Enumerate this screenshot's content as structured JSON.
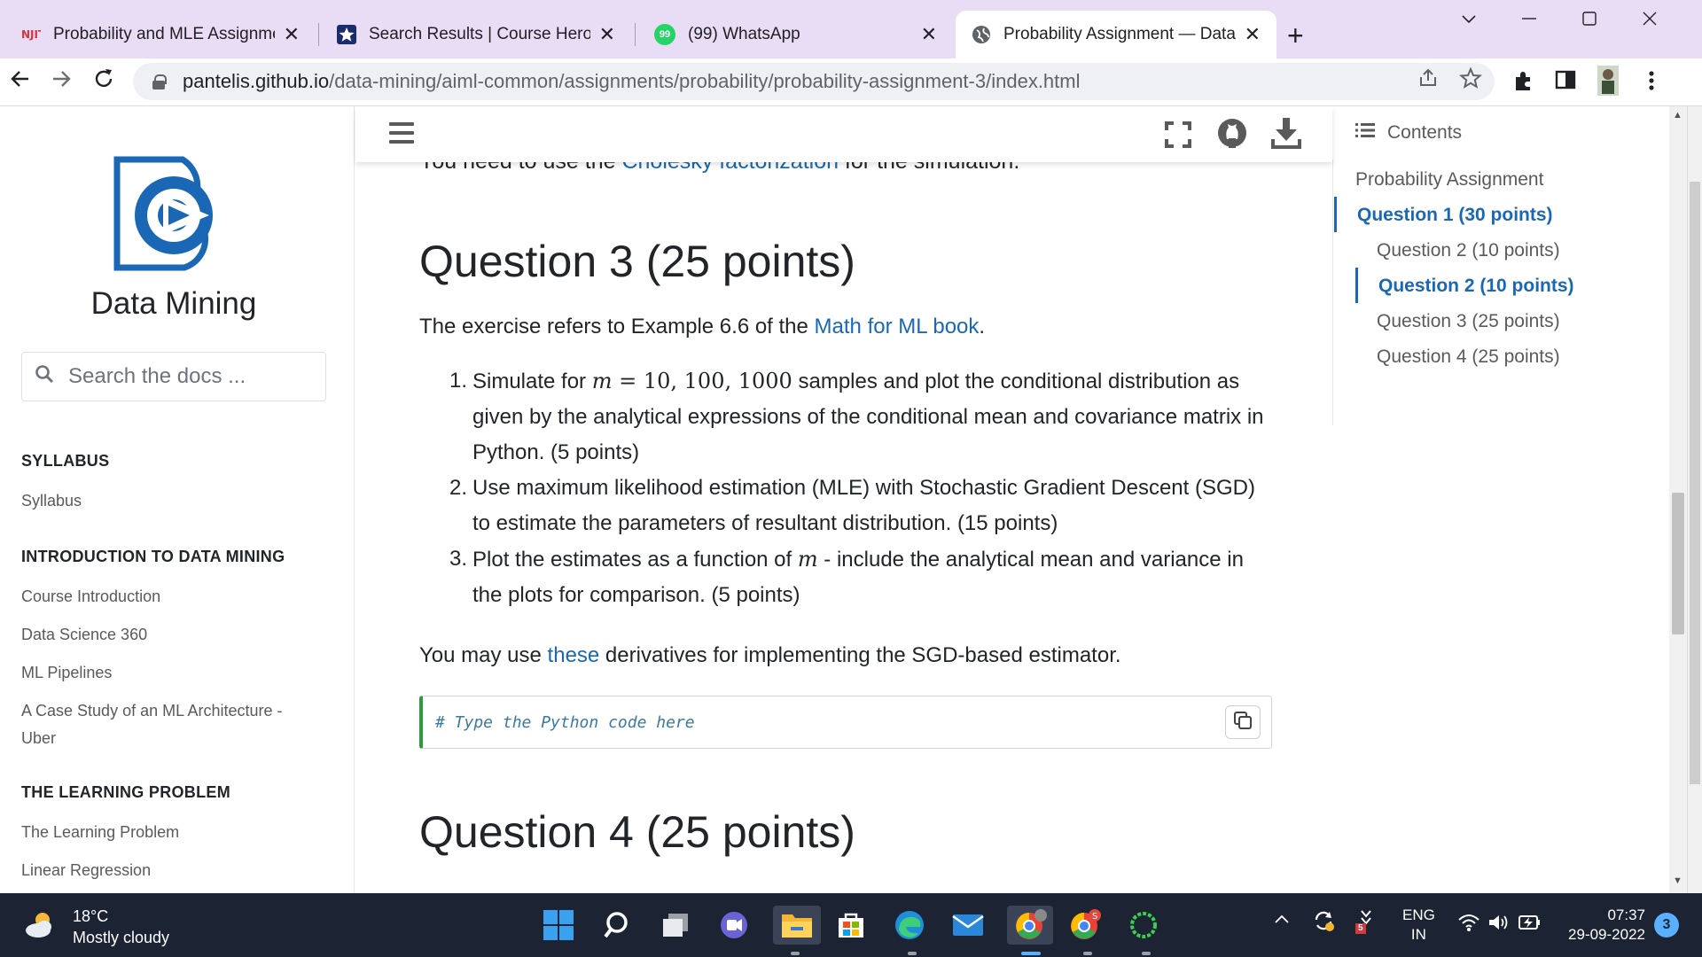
{
  "browser": {
    "tabs": [
      {
        "title": "Probability and MLE Assignment",
        "close": "✕"
      },
      {
        "title": "Search Results | Course Hero",
        "close": "✕"
      },
      {
        "title": "(99) WhatsApp",
        "badge": "99",
        "close": "✕"
      },
      {
        "title": "Probability Assignment — Data M",
        "close": "✕"
      }
    ],
    "url_host": "pantelis.github.io",
    "url_path": "/data-mining/aiml-common/assignments/probability/probability-assignment-3/index.html"
  },
  "sidebar": {
    "site_title": "Data Mining",
    "search_placeholder": "Search the docs ...",
    "sections": [
      {
        "caption": "SYLLABUS",
        "links": [
          "Syllabus"
        ]
      },
      {
        "caption": "INTRODUCTION TO DATA MINING",
        "links": [
          "Course Introduction",
          "Data Science 360",
          "ML Pipelines",
          "A Case Study of an ML Architecture - Uber"
        ]
      },
      {
        "caption": "THE LEARNING PROBLEM",
        "links": [
          "The Learning Problem",
          "Linear Regression"
        ]
      }
    ]
  },
  "content": {
    "clipped_line": {
      "pre": "You need to use the ",
      "link": "Cholesky factorization",
      "post": " for the simulation."
    },
    "q3_heading": "Question 3 (25 points)",
    "q3_intro": {
      "pre": "The exercise refers to Example 6.6 of the ",
      "link": "Math for ML book",
      "post": "."
    },
    "items": [
      {
        "num": "1.",
        "pre": "Simulate for ",
        "var": "m",
        "eq": " = ",
        "vals": "10, 100, 1000",
        "post": " samples and plot the conditional distribution as given by the analytical expressions of the conditional mean and covariance matrix in Python. (5 points)"
      },
      {
        "num": "2.",
        "text": "Use maximum likelihood estimation (MLE) with Stochastic Gradient Descent (SGD) to estimate the parameters of resultant distribution. (15 points)"
      },
      {
        "num": "3.",
        "pre": "Plot the estimates as a function of ",
        "var": "m",
        "post": " - include the analytical mean and variance in the plots for comparison. (5 points)"
      }
    ],
    "derivatives": {
      "pre": "You may use ",
      "link": "these",
      "post": " derivatives for implementing the SGD-based estimator."
    },
    "code": "# Type the Python code here",
    "q4_heading": "Question 4 (25 points)"
  },
  "toc": {
    "header": "Contents",
    "items": [
      {
        "label": "Probability Assignment",
        "active": false
      },
      {
        "label": "Question 1 (30 points)",
        "active": true
      },
      {
        "label": "Question 2 (10 points)",
        "active": false
      },
      {
        "label": "Question 2 (10 points)",
        "active": true
      },
      {
        "label": "Question 3 (25 points)",
        "active": false
      },
      {
        "label": "Question 4 (25 points)",
        "active": false
      }
    ]
  },
  "taskbar": {
    "weather_temp": "18°C",
    "weather_desc": "Mostly cloudy",
    "lang_top": "ENG",
    "lang_bottom": "IN",
    "time": "07:37",
    "date": "29-09-2022",
    "notifications": "3",
    "tray_badge": "5"
  },
  "colors": {
    "accent_link": "#1a68b5",
    "logo_blue": "#1a68b5",
    "tab_strip": "#e9dcf5",
    "taskbar": "#1c2433"
  }
}
